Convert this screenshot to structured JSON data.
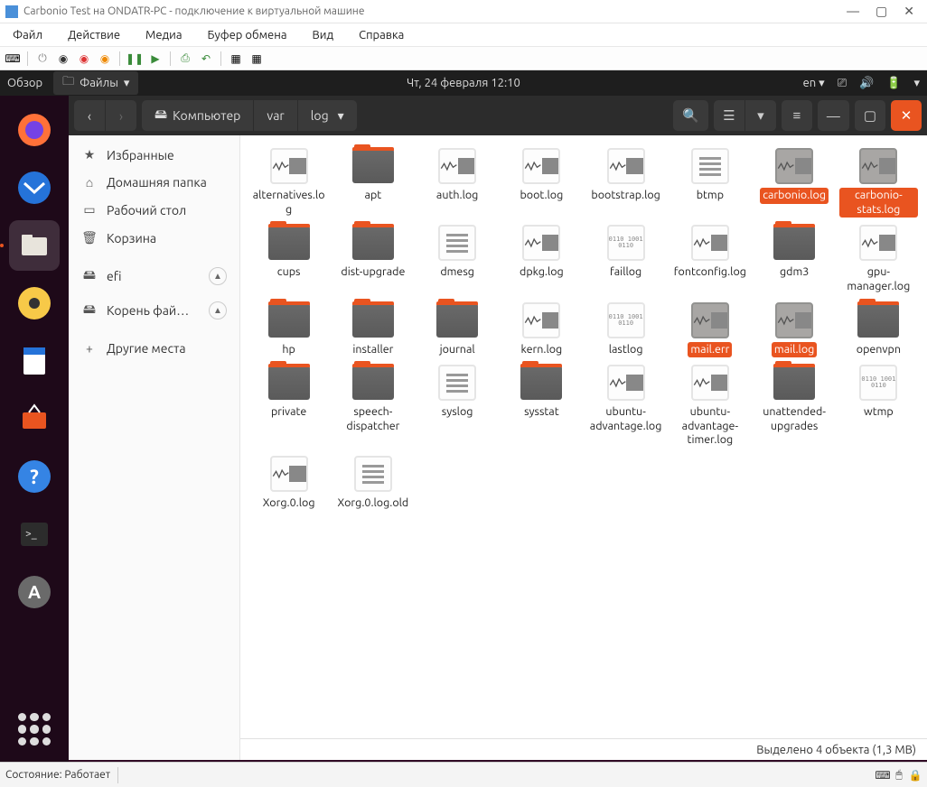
{
  "hv": {
    "title": "Carbonio Test на ONDATR-PC - подключение к виртуальной машине",
    "menu": [
      "Файл",
      "Действие",
      "Медиа",
      "Буфер обмена",
      "Вид",
      "Справка"
    ],
    "status": "Состояние: Работает"
  },
  "ubuntu": {
    "overview": "Обзор",
    "files_label": "Файлы",
    "clock": "Чт, 24 февраля  12:10",
    "lang": "en"
  },
  "nautilus": {
    "path": {
      "root": "Компьютер",
      "segs": [
        "var",
        "log"
      ]
    },
    "sidebar": {
      "favorites": "Избранные",
      "home": "Домашняя папка",
      "desktop": "Рабочий стол",
      "trash": "Корзина",
      "efi": "efi",
      "root_fs": "Корень фай…",
      "other": "Другие места"
    },
    "status": "Выделено 4 объекта  (1,3 MB)",
    "files": [
      {
        "n": "alternatives.log",
        "t": "log"
      },
      {
        "n": "apt",
        "t": "folder"
      },
      {
        "n": "auth.log",
        "t": "log"
      },
      {
        "n": "boot.log",
        "t": "log"
      },
      {
        "n": "bootstrap.log",
        "t": "log"
      },
      {
        "n": "btmp",
        "t": "txt"
      },
      {
        "n": "carbonio.log",
        "t": "log",
        "sel": true
      },
      {
        "n": "carbonio-stats.log",
        "t": "log",
        "sel": true
      },
      {
        "n": "cups",
        "t": "folder"
      },
      {
        "n": "dist-upgrade",
        "t": "folder"
      },
      {
        "n": "dmesg",
        "t": "txt"
      },
      {
        "n": "dpkg.log",
        "t": "log"
      },
      {
        "n": "faillog",
        "t": "bin"
      },
      {
        "n": "fontconfig.log",
        "t": "log"
      },
      {
        "n": "gdm3",
        "t": "folder"
      },
      {
        "n": "gpu-manager.log",
        "t": "log"
      },
      {
        "n": "hp",
        "t": "folder"
      },
      {
        "n": "installer",
        "t": "folder"
      },
      {
        "n": "journal",
        "t": "folder"
      },
      {
        "n": "kern.log",
        "t": "log"
      },
      {
        "n": "lastlog",
        "t": "bin"
      },
      {
        "n": "mail.err",
        "t": "log",
        "sel": true
      },
      {
        "n": "mail.log",
        "t": "log",
        "sel": true
      },
      {
        "n": "openvpn",
        "t": "folder"
      },
      {
        "n": "private",
        "t": "folder"
      },
      {
        "n": "speech-dispatcher",
        "t": "folder"
      },
      {
        "n": "syslog",
        "t": "txt"
      },
      {
        "n": "sysstat",
        "t": "folder"
      },
      {
        "n": "ubuntu-advantage.log",
        "t": "log"
      },
      {
        "n": "ubuntu-advantage-timer.log",
        "t": "log"
      },
      {
        "n": "unattended-upgrades",
        "t": "folder"
      },
      {
        "n": "wtmp",
        "t": "bin"
      },
      {
        "n": "Xorg.0.log",
        "t": "log"
      },
      {
        "n": "Xorg.0.log.old",
        "t": "txt"
      }
    ]
  }
}
